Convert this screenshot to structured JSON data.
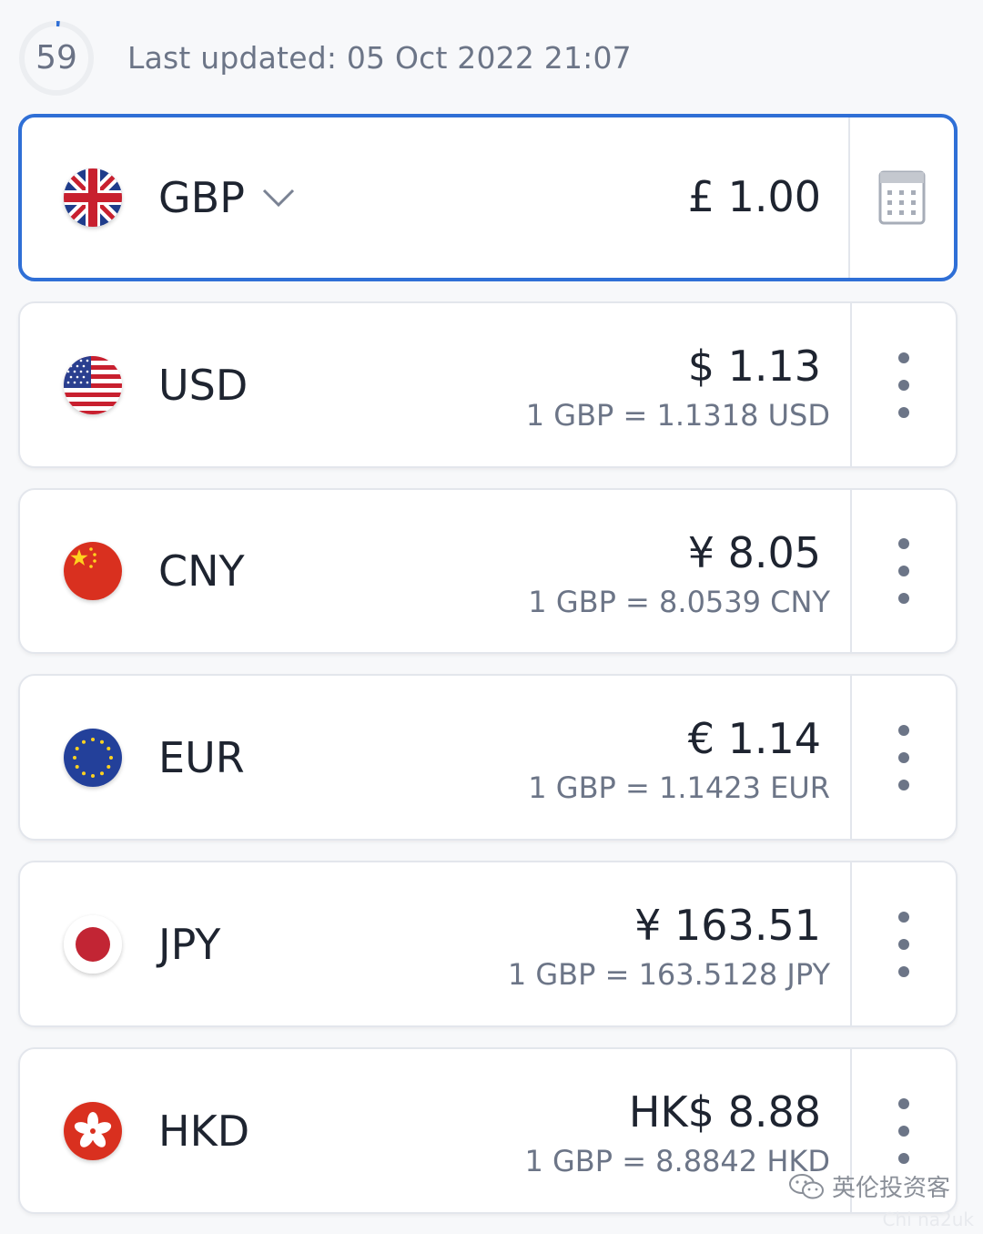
{
  "header": {
    "countdown": "59",
    "last_updated": "Last updated: 05 Oct 2022 21:07"
  },
  "base": {
    "code": "GBP",
    "amount": "£ 1.00",
    "flag_icon": "uk-flag-icon",
    "dropdown_icon": "chevron-down-icon",
    "calculator_icon": "calculator-icon"
  },
  "conversions": [
    {
      "code": "USD",
      "amount": "$ 1.13",
      "rate": "1 GBP = 1.1318 USD",
      "flag_icon": "us-flag-icon"
    },
    {
      "code": "CNY",
      "amount": "¥ 8.05",
      "rate": "1 GBP = 8.0539 CNY",
      "flag_icon": "china-flag-icon"
    },
    {
      "code": "EUR",
      "amount": "€ 1.14",
      "rate": "1 GBP = 1.1423 EUR",
      "flag_icon": "eu-flag-icon"
    },
    {
      "code": "JPY",
      "amount": "¥ 163.51",
      "rate": "1 GBP = 163.5128 JPY",
      "flag_icon": "japan-flag-icon"
    },
    {
      "code": "HKD",
      "amount": "HK$ 8.88",
      "rate": "1 GBP = 8.8842 HKD",
      "flag_icon": "hong-kong-flag-icon"
    }
  ],
  "watermark": {
    "text": "英伦投资客",
    "sub": "Chi na2uk"
  },
  "colors": {
    "accent": "#2f6fd6",
    "text_primary": "#1e2430",
    "text_secondary": "#6c7587",
    "background": "#f7f8fa"
  }
}
